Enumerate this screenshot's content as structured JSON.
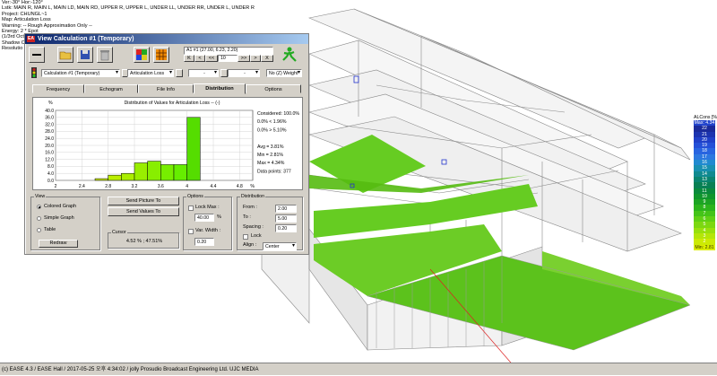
{
  "info_lines": [
    "Ver:-30°  Hor:-120°",
    "Lstk: MAIN R, MAIN L, MAIN LD, MAIN RD, UPPER R, UPPER L, UNDER LL, UNDER RR, UNDER L, UNDER R",
    "Project: CHUNGL~1",
    "Map: Articulation Loss",
    "Warning:   -- Rough Approximation Only --",
    "Energy: 2 * Epot",
    "(1/3rd Oct",
    "Shadow C",
    "Resolutio"
  ],
  "window": {
    "title": "View Calculation #1 (Temporary)",
    "position_readout": "A1 #1  (27.00, 6.23, 2.20)",
    "step_value": "10",
    "calculation_select": "Calculation #1 (Temporary)",
    "map_select": "Articulation Loss",
    "freq_select": "-",
    "extra_select": "-",
    "weight_select": "No (Z) Weight",
    "nav_buttons": [
      "K",
      "<",
      "<<",
      ">>",
      ">",
      "X"
    ],
    "tabs": [
      "Frequency",
      "Echogram",
      "File Info",
      "Distribution",
      "Options"
    ],
    "active_tab": "Distribution"
  },
  "chart_data": {
    "type": "bar",
    "title": "Distribution of Values for Articulation Loss  -- (-)",
    "ylabel": "%",
    "xlabel": "%",
    "ylim": [
      0,
      40
    ],
    "yticks": [
      "40.0",
      "36.0",
      "32.0",
      "28.0",
      "24.0",
      "20.0",
      "16.0",
      "12.0",
      "8.0",
      "4.0",
      "0.0"
    ],
    "xlim": [
      2,
      5
    ],
    "xticks": [
      "2",
      "2.4",
      "2.8",
      "3.2",
      "3.6",
      "4",
      "4.4",
      "4.8"
    ],
    "bin_width": 0.2,
    "bins": [
      {
        "start": 2.6,
        "value": 1.0,
        "color": "#ccee00"
      },
      {
        "start": 2.8,
        "value": 3.0,
        "color": "#bbee00"
      },
      {
        "start": 3.0,
        "value": 4.0,
        "color": "#aaee00"
      },
      {
        "start": 3.2,
        "value": 10.0,
        "color": "#99ee00"
      },
      {
        "start": 3.4,
        "value": 11.0,
        "color": "#88ee00"
      },
      {
        "start": 3.6,
        "value": 9.0,
        "color": "#77ee00"
      },
      {
        "start": 3.8,
        "value": 9.0,
        "color": "#66ee00"
      },
      {
        "start": 4.0,
        "value": 36.0,
        "color": "#55dd00"
      }
    ],
    "stats": [
      "Considered: 100.0%",
      "0.0% < 1.96%",
      "0.0% > 5.10%",
      "",
      "Avg = 3.81%",
      "Min = 2.81%",
      "Max = 4.34%",
      "Data points:  377"
    ]
  },
  "view_group": {
    "caption": "View",
    "options": [
      "Colored Graph",
      "Simple Graph",
      "Table"
    ],
    "selected": "Colored Graph",
    "redraw_label": "Redraw"
  },
  "send_picture_label": "Send Picture To",
  "send_values_label": "Send Values To",
  "cursor": {
    "caption": "Cursor",
    "value": "4.52 % ; 47.51%"
  },
  "options_group": {
    "caption": "Options",
    "lock_max_label": "Lock Max :",
    "lock_max_value": "40.00",
    "lock_max_unit": "%",
    "var_width_label": "Var. Width :",
    "var_width_value": "0.20"
  },
  "distribution_group": {
    "caption": "Distribution",
    "from_label": "From :",
    "from_value": "2.00",
    "to_label": "To :",
    "to_value": "5.00",
    "spacing_label": "Spacing :",
    "spacing_value": "0.20",
    "lock_label": "Lock",
    "align_label": "Align :",
    "align_value": "Center"
  },
  "legend": {
    "title": "ALCons [%]",
    "rows": [
      {
        "label": "Max: 4.34",
        "color": "#2244cc",
        "text": "#ffffff"
      },
      {
        "label": "22",
        "color": "#1a2a9a",
        "text": "#ffffff"
      },
      {
        "label": "21",
        "color": "#1c34b0",
        "text": "#ffffff"
      },
      {
        "label": "20",
        "color": "#2040c8",
        "text": "#ffffff"
      },
      {
        "label": "19",
        "color": "#2450d8",
        "text": "#ffffff"
      },
      {
        "label": "18",
        "color": "#2864e0",
        "text": "#ffffff"
      },
      {
        "label": "17",
        "color": "#2c78e0",
        "text": "#ffffff"
      },
      {
        "label": "16",
        "color": "#208ad0",
        "text": "#ffffff"
      },
      {
        "label": "15",
        "color": "#1890b0",
        "text": "#ffffff"
      },
      {
        "label": "14",
        "color": "#108a90",
        "text": "#ffffff"
      },
      {
        "label": "13",
        "color": "#0a8470",
        "text": "#ffffff"
      },
      {
        "label": "12",
        "color": "#088054",
        "text": "#ffffff"
      },
      {
        "label": "11",
        "color": "#0a8a3c",
        "text": "#ffffff"
      },
      {
        "label": "10",
        "color": "#10962c",
        "text": "#ffffff"
      },
      {
        "label": "9",
        "color": "#1ca424",
        "text": "#ffffff"
      },
      {
        "label": "8",
        "color": "#2cb41c",
        "text": "#ffffff"
      },
      {
        "label": "7",
        "color": "#44c418",
        "text": "#ffffff"
      },
      {
        "label": "6",
        "color": "#60d014",
        "text": "#ffffff"
      },
      {
        "label": "5",
        "color": "#7cd810",
        "text": "#ffffff"
      },
      {
        "label": "4",
        "color": "#98e00c",
        "text": "#ffffff"
      },
      {
        "label": "3",
        "color": "#b4e608",
        "text": "#ffffff"
      },
      {
        "label": "2",
        "color": "#ccea04",
        "text": "#ffffff"
      },
      {
        "label": "Min: 2.81",
        "color": "#dcee00",
        "text": "#333300"
      }
    ]
  },
  "status_text": "(c) EASE 4.3  / EASE Hall  / 2017-05-25 오후 4:34:02 / jolly Prosudio Broadcast Engineering Ltd. UJC MEDIA"
}
